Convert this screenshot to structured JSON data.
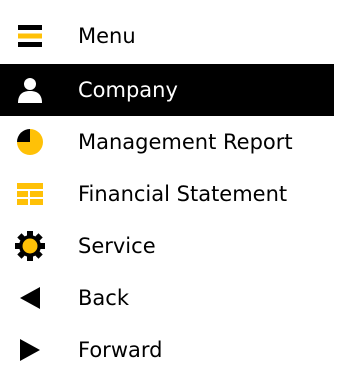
{
  "menu": {
    "items": [
      {
        "label": "Menu",
        "icon": "hamburger-icon",
        "active": false
      },
      {
        "label": "Company",
        "icon": "user-icon",
        "active": true
      },
      {
        "label": "Management Report",
        "icon": "pie-chart-icon",
        "active": false
      },
      {
        "label": "Financial Statement",
        "icon": "table-icon",
        "active": false
      },
      {
        "label": "Service",
        "icon": "gear-icon",
        "active": false
      },
      {
        "label": "Back",
        "icon": "triangle-left-icon",
        "active": false
      },
      {
        "label": "Forward",
        "icon": "triangle-right-icon",
        "active": false
      }
    ]
  },
  "colors": {
    "accent": "#ffc107",
    "text": "#000000",
    "active_background": "#000000",
    "active_text": "#ffffff"
  }
}
